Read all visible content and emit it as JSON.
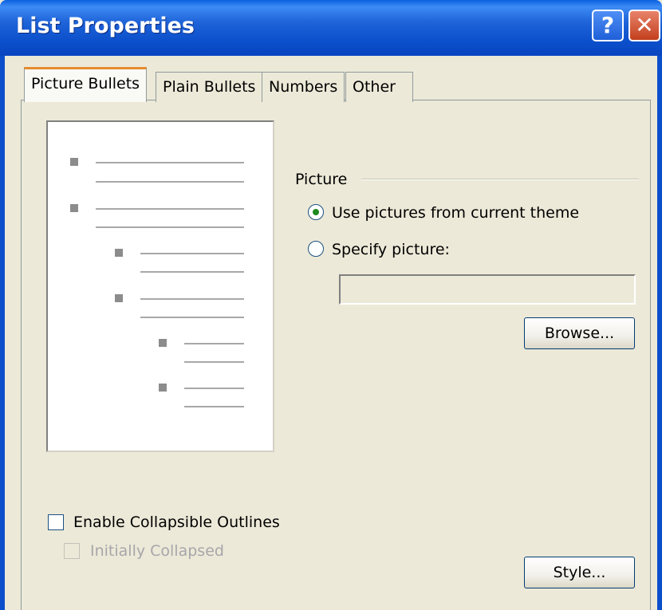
{
  "window": {
    "title": "List Properties"
  },
  "titlebar": {
    "help_glyph": "?",
    "close_glyph": "✕"
  },
  "tabs": [
    {
      "label": "Picture Bullets",
      "active": true
    },
    {
      "label": "Plain Bullets",
      "active": false
    },
    {
      "label": "Numbers",
      "active": false
    },
    {
      "label": "Other",
      "active": false
    }
  ],
  "picture_group": {
    "label": "Picture",
    "options": [
      {
        "label": "Use pictures from current theme",
        "selected": true
      },
      {
        "label": "Specify picture:",
        "selected": false
      }
    ],
    "picture_path": {
      "value": ""
    },
    "browse_label": "Browse..."
  },
  "outlines": {
    "enable_label": "Enable Collapsible Outlines",
    "enable_checked": false,
    "collapsed_label": "Initially Collapsed",
    "collapsed_checked": false,
    "collapsed_enabled": false
  },
  "style_label": "Style...",
  "colors": {
    "titlebar": "#0B4FCB",
    "face": "#ECE9D8",
    "active_tab_accent": "#E68B2C"
  }
}
